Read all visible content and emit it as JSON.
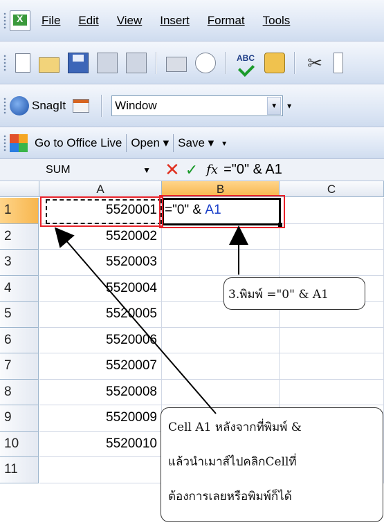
{
  "menu": {
    "items": [
      {
        "label": "File"
      },
      {
        "label": "Edit"
      },
      {
        "label": "View"
      },
      {
        "label": "Insert"
      },
      {
        "label": "Format"
      },
      {
        "label": "Tools"
      }
    ]
  },
  "snagit": {
    "label": "SnagIt",
    "window_value": "Window"
  },
  "office": {
    "go_live": "Go to Office Live",
    "open": "Open ▾",
    "save": "Save ▾"
  },
  "formula_bar": {
    "name_box": "SUM",
    "fx": "fx",
    "formula": "=\"0\" & A1"
  },
  "sheet": {
    "columns": [
      "A",
      "B",
      "C"
    ],
    "rows": [
      {
        "row": "1",
        "a": "5520001"
      },
      {
        "row": "2",
        "a": "5520002"
      },
      {
        "row": "3",
        "a": "5520003"
      },
      {
        "row": "4",
        "a": "5520004"
      },
      {
        "row": "5",
        "a": "5520005"
      },
      {
        "row": "6",
        "a": "5520006"
      },
      {
        "row": "7",
        "a": "5520007"
      },
      {
        "row": "8",
        "a": "5520008"
      },
      {
        "row": "9",
        "a": "5520009"
      },
      {
        "row": "10",
        "a": "5520010"
      },
      {
        "row": "11",
        "a": ""
      }
    ],
    "b1_text": "=\"0\" & ",
    "b1_ref": "A1"
  },
  "callouts": {
    "step3": "3.พิมพ์ =\"0\" & A1",
    "note": [
      "Cell A1 หลังจากที่พิมพ์ &",
      "แล้วนำเมาส์ไปคลิกCellที่",
      "ต้องการเลยหรือพิมพ์ก็ได้"
    ]
  },
  "colors": {
    "selected_header": "#f7b64e",
    "highlight_box": "#e8222a",
    "ref_blue": "#1a3fc9"
  }
}
